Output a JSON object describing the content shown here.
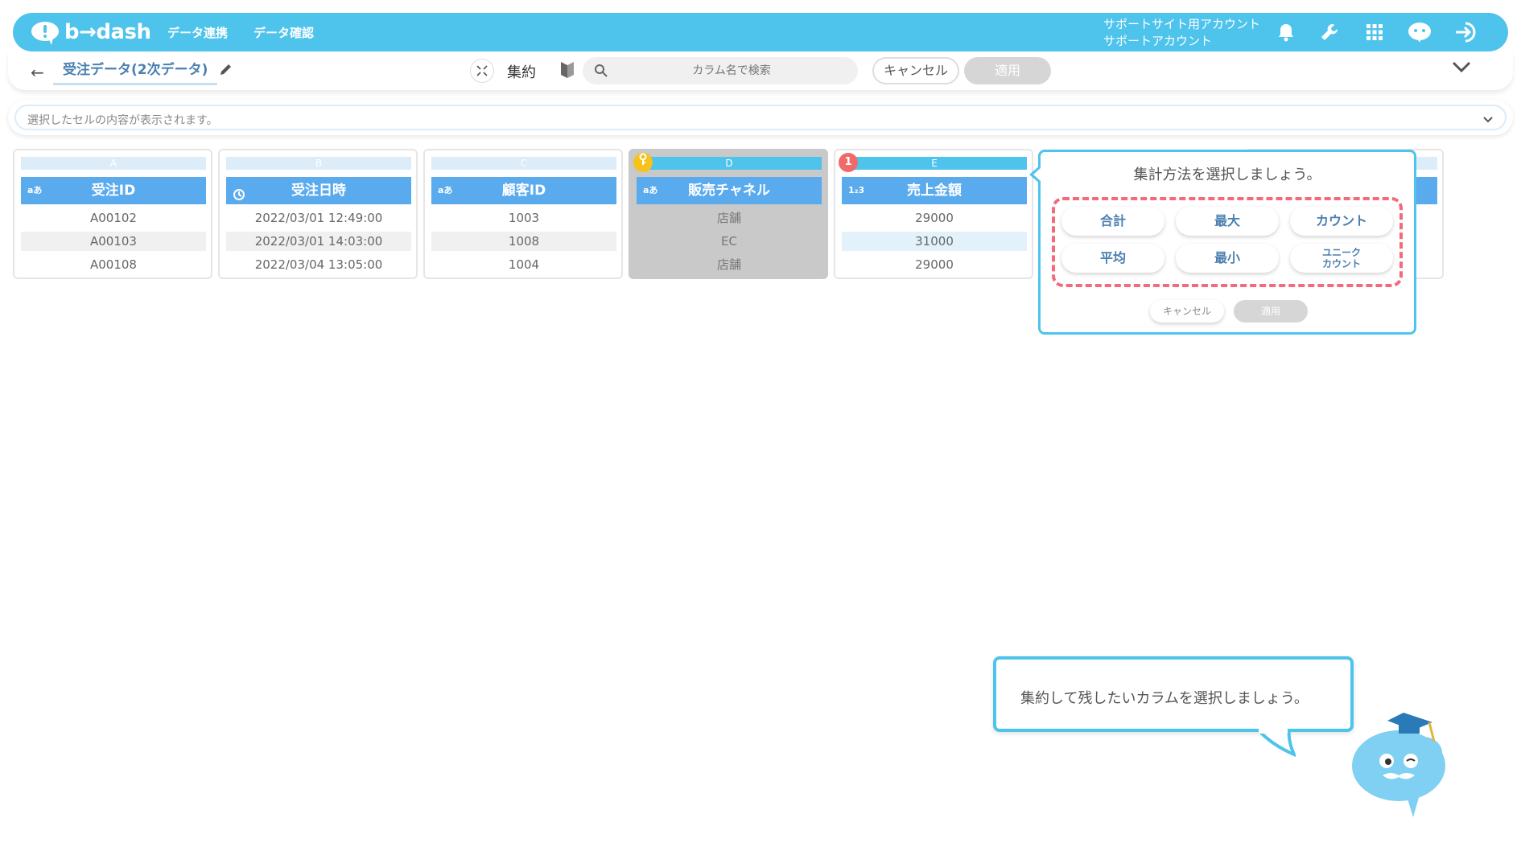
{
  "app": {
    "logo_text": "b→dash",
    "nav": [
      "データ連携",
      "データ確認"
    ],
    "account_line1": "サポートサイト用アカウント",
    "account_line2": "サポートアカウント",
    "accent_color": "#4ec3ec",
    "icons": [
      "bell-icon",
      "wrench-icon",
      "grid-icon",
      "chat-icon",
      "logout-icon"
    ]
  },
  "toolbar": {
    "back_icon": "←",
    "title": "受注データ(2次データ)",
    "mode_label": "集約",
    "search_placeholder": "カラム名で検索",
    "cancel_label": "キャンセル",
    "apply_label": "適用"
  },
  "cellbar": {
    "placeholder": "選択したセルの内容が表示されます。"
  },
  "columns": [
    {
      "letter": "A",
      "type": "aあ",
      "name": "受注ID",
      "cells": [
        "A00102",
        "A00103",
        "A00108"
      ]
    },
    {
      "letter": "B",
      "type": "clock",
      "name": "受注日時",
      "cells": [
        "2022/03/01 12:49:00",
        "2022/03/01 14:03:00",
        "2022/03/04 13:05:00"
      ]
    },
    {
      "letter": "C",
      "type": "aあ",
      "name": "顧客ID",
      "cells": [
        "1003",
        "1008",
        "1004"
      ]
    },
    {
      "letter": "D",
      "type": "aあ",
      "name": "販売チャネル",
      "cells": [
        "店舗",
        "EC",
        "店舗"
      ],
      "badge": "key"
    },
    {
      "letter": "E",
      "type": "1₂3",
      "name": "売上金額",
      "cells": [
        "29000",
        "31000",
        "29000"
      ],
      "badge": "1"
    }
  ],
  "popup": {
    "title": "集計方法を選択しましょう。",
    "options": [
      "合計",
      "最大",
      "カウント",
      "平均",
      "最小",
      "ユニーク\nカウント"
    ],
    "option_unique_line1": "ユニーク",
    "option_unique_line2": "カウント",
    "cancel_label": "キャンセル",
    "apply_label": "適用",
    "highlight_color": "#f36b7b"
  },
  "hint": {
    "text": "集約して残したいカラムを選択しましょう。"
  }
}
